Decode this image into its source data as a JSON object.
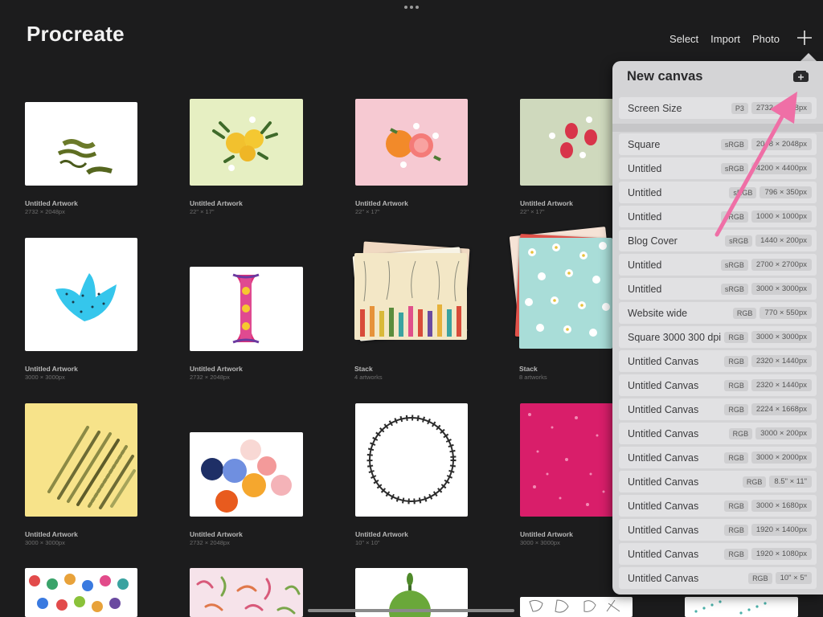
{
  "app_title": "Procreate",
  "top_actions": {
    "select": "Select",
    "import": "Import",
    "photo": "Photo"
  },
  "artworks": [
    {
      "name": "Untitled Artwork",
      "size": "2732 × 2048px"
    },
    {
      "name": "Untitled Artwork",
      "size": "22\" × 17\""
    },
    {
      "name": "Untitled Artwork",
      "size": "22\" × 17\""
    },
    {
      "name": "Untitled Artwork",
      "size": "22\" × 17\""
    },
    {
      "name": "Untitled Artwork",
      "size": "3000 × 3000px"
    },
    {
      "name": "Untitled Artwork",
      "size": "2732 × 2048px"
    },
    {
      "name": "Stack",
      "size": "4 artworks"
    },
    {
      "name": "Stack",
      "size": "8 artworks"
    },
    {
      "name": "Untitled Artwork",
      "size": "3000 × 3000px"
    },
    {
      "name": "Untitled Artwork",
      "size": "2732 × 2048px"
    },
    {
      "name": "Untitled Artwork",
      "size": "10\" × 10\""
    },
    {
      "name": "Untitled Artwork",
      "size": "3000 × 3000px"
    }
  ],
  "new_canvas": {
    "title": "New canvas",
    "screen_size": {
      "name": "Screen Size",
      "colorspace": "P3",
      "dims": "2732 × 2048px"
    },
    "presets": [
      {
        "name": "Square",
        "colorspace": "sRGB",
        "dims": "2048 × 2048px"
      },
      {
        "name": "Untitled",
        "colorspace": "sRGB",
        "dims": "4200 × 4400px"
      },
      {
        "name": "Untitled",
        "colorspace": "sRGB",
        "dims": "796 × 350px"
      },
      {
        "name": "Untitled",
        "colorspace": "sRGB",
        "dims": "1000 × 1000px"
      },
      {
        "name": "Blog Cover",
        "colorspace": "sRGB",
        "dims": "1440 × 200px"
      },
      {
        "name": "Untitled",
        "colorspace": "sRGB",
        "dims": "2700 × 2700px"
      },
      {
        "name": "Untitled",
        "colorspace": "sRGB",
        "dims": "3000 × 3000px"
      },
      {
        "name": "Website wide",
        "colorspace": "RGB",
        "dims": "770 × 550px"
      },
      {
        "name": "Square 3000 300 dpi",
        "colorspace": "RGB",
        "dims": "3000 × 3000px"
      },
      {
        "name": "Untitled Canvas",
        "colorspace": "RGB",
        "dims": "2320 × 1440px"
      },
      {
        "name": "Untitled Canvas",
        "colorspace": "RGB",
        "dims": "2320 × 1440px"
      },
      {
        "name": "Untitled Canvas",
        "colorspace": "RGB",
        "dims": "2224 × 1668px"
      },
      {
        "name": "Untitled Canvas",
        "colorspace": "RGB",
        "dims": "3000 × 200px"
      },
      {
        "name": "Untitled Canvas",
        "colorspace": "RGB",
        "dims": "3000 × 2000px"
      },
      {
        "name": "Untitled Canvas",
        "colorspace": "RGB",
        "dims": "8.5\" × 11\""
      },
      {
        "name": "Untitled Canvas",
        "colorspace": "RGB",
        "dims": "3000 × 1680px"
      },
      {
        "name": "Untitled Canvas",
        "colorspace": "RGB",
        "dims": "1920 × 1400px"
      },
      {
        "name": "Untitled Canvas",
        "colorspace": "RGB",
        "dims": "1920 × 1080px"
      },
      {
        "name": "Untitled Canvas",
        "colorspace": "RGB",
        "dims": "10\" × 5\""
      }
    ]
  },
  "colors": {
    "background": "#1c1c1d",
    "popover": "#d4d4d6",
    "annotation_arrow": "#ef6fa6"
  },
  "icons": {
    "add": "plus-icon",
    "new_canvas": "new-canvas-icon",
    "more": "ellipsis-icon"
  }
}
